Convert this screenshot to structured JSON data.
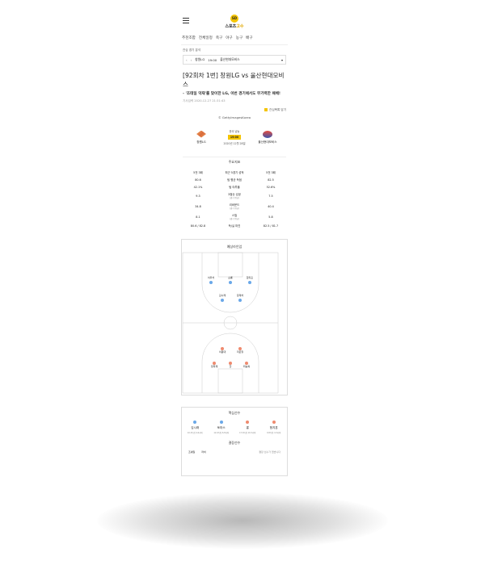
{
  "header": {
    "logo_mark": "SD",
    "logo_text": "스포츠",
    "logo_accent": "고수"
  },
  "nav": [
    "추천조합",
    "전체일정",
    "축구",
    "야구",
    "농구",
    "배구"
  ],
  "analysis_label": "관심 경기 분석",
  "selector": {
    "home": "창원LG",
    "time": "19:00",
    "away": "울산현대모비스"
  },
  "article": {
    "title": "[92회차 1번] 창원LG vs 울산현대모비스",
    "subtitle": "- '조테일 악재'를 맞이한 LG, 이번 경기에서도 무기력한 패배!",
    "meta": "기사입력 2020-12-27 21:31:43",
    "share": "관심목록 담기",
    "credit": "© GettyImagesKorea"
  },
  "match": {
    "home": "창원LG",
    "away": "울산현대모비스",
    "league": "한국 남농",
    "time": "19:00",
    "date": "2020년 12월 28일"
  },
  "stats": {
    "header": "주요지표",
    "rows": [
      {
        "label": "최근 5경기 성적",
        "sub": "",
        "home": "5전 3패",
        "away": "5전 3패"
      },
      {
        "label": "팀 평균 득점",
        "sub": "",
        "home": "80.6",
        "away": "82.5"
      },
      {
        "label": "팀 야투율",
        "sub": "",
        "home": "42.1%",
        "away": "52.6%"
      },
      {
        "label": "3점슛 성공",
        "sub": "(경기 평균)",
        "home": "9.3",
        "away": "7.5"
      },
      {
        "label": "리바운드",
        "sub": "(경기 평균)",
        "home": "34.8",
        "away": "40.4"
      },
      {
        "label": "스틸",
        "sub": "(경기 평균)",
        "home": "8.1",
        "away": "5.8"
      },
      {
        "label": "득/실 마진",
        "sub": "",
        "home": "80.6 / 82.8",
        "away": "82.5 / 81.7"
      }
    ]
  },
  "court": {
    "title": "예상라인업",
    "top_players": [
      "이우석",
      "숀롱",
      "함지훈",
      "김시래",
      "장재석"
    ],
    "bottom_players": [
      "이원대",
      "리온윌",
      "정희재",
      "한",
      "최승욱"
    ]
  },
  "key_players": {
    "title": "핵심선수",
    "players": [
      {
        "name": "김시래",
        "stat": "10.4득점 4.6리바",
        "color": "#6aa8e8"
      },
      {
        "name": "토마스",
        "stat": "12.6득점 6.8리바",
        "color": "#6aa8e8"
      },
      {
        "name": "롱",
        "stat": "17.6득점 10.3리바",
        "color": "#ef8a6e"
      },
      {
        "name": "함지훈",
        "stat": "9.8득점 4.3리바",
        "color": "#ef8a6e"
      }
    ]
  },
  "absent": {
    "title": "결장선수",
    "p1": "조쉐일",
    "p2": "라비",
    "none": "결장 선수가 없습니다"
  }
}
